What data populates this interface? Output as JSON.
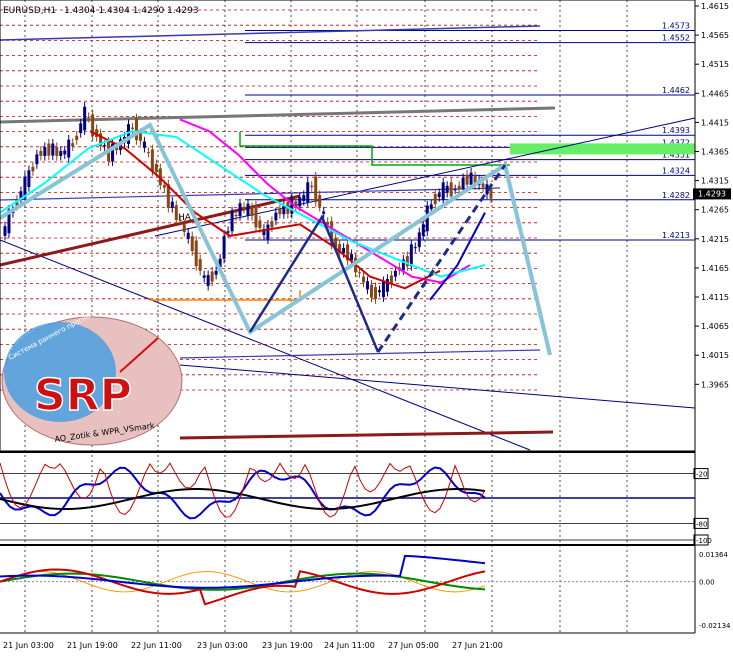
{
  "header": {
    "symbol": "EURUSD,H1",
    "ohlc": "1.4304 1.4304 1.4290 1.4293"
  },
  "colors": {
    "background": "#ffffff",
    "axis": "#000000",
    "grid": "#000000",
    "candle_bull": "#000080",
    "candle_bear": "#8b4513",
    "dotted_levels": "#cc0000",
    "level_lines": "#00008b",
    "current_price_box": "#000000",
    "green_zone": "#66ee66",
    "pattern_light_blue": "#87c4d8",
    "pattern_navy": "#1e2a8c"
  },
  "chart_data": [
    {
      "type": "candlestick",
      "panel": "main",
      "ylim": [
        1.393,
        1.4625
      ],
      "y_tick_labels": [
        "1.4615",
        "1.4565",
        "1.4515",
        "1.4465",
        "1.4415",
        "1.4365",
        "1.4315",
        "1.4265",
        "1.4215",
        "1.4165",
        "1.4115",
        "1.4065",
        "1.4015",
        "1.3965"
      ],
      "current_price": "1.4293",
      "level_labels": [
        "1.4573",
        "1.4552",
        "1.4462",
        "1.4393",
        "1.4372",
        "1.4351",
        "1.4324",
        "1.4282",
        "1.4213"
      ],
      "text_labels": [
        "HA"
      ],
      "close_path": [
        1.422,
        1.427,
        1.431,
        1.436,
        1.437,
        1.436,
        1.438,
        1.443,
        1.439,
        1.436,
        1.438,
        1.441,
        1.437,
        1.433,
        1.428,
        1.424,
        1.42,
        1.414,
        1.416,
        1.424,
        1.427,
        1.426,
        1.422,
        1.426,
        1.427,
        1.428,
        1.431,
        1.425,
        1.42,
        1.419,
        1.415,
        1.412,
        1.413,
        1.416,
        1.418,
        1.422,
        1.428,
        1.43,
        1.43,
        1.432,
        1.431,
        1.429
      ],
      "moving_averages": [
        {
          "color": "#ff00ff",
          "values": [
            1.442,
            1.44,
            1.436,
            1.431,
            1.427,
            1.424,
            1.421,
            1.418,
            1.415,
            1.414,
            1.417
          ]
        },
        {
          "color": "#cc0000",
          "values": [
            1.44,
            1.437,
            1.432,
            1.426,
            1.422,
            1.423,
            1.424,
            1.42,
            1.415,
            1.413,
            1.416
          ]
        },
        {
          "color": "#00ffff",
          "values": [
            1.426,
            1.431,
            1.437,
            1.44,
            1.439,
            1.434,
            1.429,
            1.425,
            1.421,
            1.418,
            1.415,
            1.417
          ]
        },
        {
          "color": "#0000cc",
          "values": [
            1.411,
            1.417,
            1.426
          ]
        }
      ]
    },
    {
      "type": "line",
      "panel": "oscillator-1",
      "ylim": [
        -100,
        0
      ],
      "y_tick_labels": [
        "-20",
        "-80",
        "-100"
      ]
    },
    {
      "type": "line",
      "panel": "oscillator-2",
      "ylim": [
        -0.02134,
        0.01364
      ],
      "y_tick_labels": [
        "0.01364",
        "0.00",
        "-0.02134"
      ]
    },
    {
      "type": "time-axis",
      "x_tick_labels": [
        "21 Jun 03:00",
        "21 Jun 19:00",
        "22 Jun 11:00",
        "23 Jun 03:00",
        "23 Jun 19:00",
        "24 Jun 11:00",
        "27 Jun 05:00",
        "27 Jun 21:00"
      ]
    }
  ],
  "logo": {
    "letters": "SRP",
    "top_text": "Система раннего прогнозирования",
    "bottom_text": "AO_Zotik & WPR_VSmark"
  }
}
